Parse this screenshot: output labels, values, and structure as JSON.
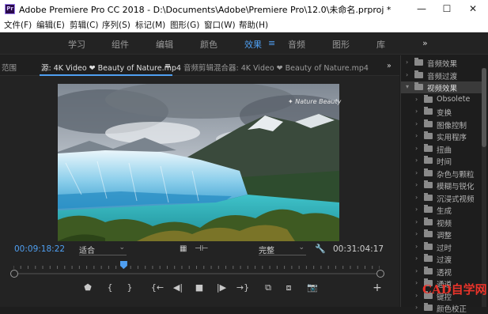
{
  "window": {
    "title": "Adobe Premiere Pro CC 2018 - D:\\Documents\\Adobe\\Premiere Pro\\12.0\\未命名.prproj *",
    "app_icon": "Pr",
    "controls": [
      "—",
      "☐",
      "✕"
    ]
  },
  "menu": [
    "文件(F)",
    "编辑(E)",
    "剪辑(C)",
    "序列(S)",
    "标记(M)",
    "图形(G)",
    "窗口(W)",
    "帮助(H)"
  ],
  "workspaces": {
    "tabs": [
      "学习",
      "组件",
      "编辑",
      "颜色",
      "效果",
      "音频",
      "图形",
      "库"
    ],
    "active": "效果",
    "more": "»"
  },
  "panel": {
    "left_cut": "范围",
    "source_tab": "源: 4K Video ❤ Beauty of Nature.mp4",
    "source_menu": "≡",
    "mixer_tab": "音频剪辑混合器: 4K Video ❤ Beauty of Nature.mp4",
    "more": "»"
  },
  "viewer": {
    "watermark": "✦ Nature Beauty",
    "timecode_current": "00:09:18:22",
    "zoom_value": "适合",
    "resolution_value": "完整",
    "timecode_duration": "00:31:04:17",
    "playhead_fraction": 0.3
  },
  "transport": {
    "buttons": [
      {
        "name": "add-marker-button",
        "glyph": "⬟"
      },
      {
        "name": "mark-in-button",
        "glyph": "{"
      },
      {
        "name": "mark-out-button",
        "glyph": "}"
      },
      {
        "name": "go-to-in-button",
        "glyph": "{←"
      },
      {
        "name": "step-back-button",
        "glyph": "◀|"
      },
      {
        "name": "stop-button",
        "glyph": "■"
      },
      {
        "name": "step-forward-button",
        "glyph": "|▶"
      },
      {
        "name": "go-to-out-button",
        "glyph": "→}"
      },
      {
        "name": "insert-button",
        "glyph": "⧉"
      },
      {
        "name": "overwrite-button",
        "glyph": "⧈"
      },
      {
        "name": "export-frame-button",
        "glyph": "📷"
      }
    ],
    "add": "+"
  },
  "effects_tree": [
    {
      "label": "音频效果",
      "level": 0,
      "open": false
    },
    {
      "label": "音频过渡",
      "level": 0,
      "open": false
    },
    {
      "label": "视频效果",
      "level": 0,
      "open": true,
      "selected": true
    },
    {
      "label": "Obsolete",
      "level": 1,
      "open": false
    },
    {
      "label": "变换",
      "level": 1,
      "open": false
    },
    {
      "label": "图像控制",
      "level": 1,
      "open": false
    },
    {
      "label": "实用程序",
      "level": 1,
      "open": false
    },
    {
      "label": "扭曲",
      "level": 1,
      "open": false
    },
    {
      "label": "时间",
      "level": 1,
      "open": false
    },
    {
      "label": "杂色与颗粒",
      "level": 1,
      "open": false
    },
    {
      "label": "模糊与锐化",
      "level": 1,
      "open": false
    },
    {
      "label": "沉浸式视频",
      "level": 1,
      "open": false
    },
    {
      "label": "生成",
      "level": 1,
      "open": false
    },
    {
      "label": "视频",
      "level": 1,
      "open": false
    },
    {
      "label": "调整",
      "level": 1,
      "open": false
    },
    {
      "label": "过时",
      "level": 1,
      "open": false
    },
    {
      "label": "过渡",
      "level": 1,
      "open": false
    },
    {
      "label": "透视",
      "level": 1,
      "open": false
    },
    {
      "label": "通道",
      "level": 1,
      "open": false
    },
    {
      "label": "键控",
      "level": 1,
      "open": false
    },
    {
      "label": "颜色校正",
      "level": 1,
      "open": false
    }
  ],
  "brand_mark": "CAD自学网",
  "colors": {
    "accent": "#4f9ff1",
    "timecode": "#4f9ff1",
    "playhead": "#4f9ff1",
    "brand": "#e8332a"
  }
}
